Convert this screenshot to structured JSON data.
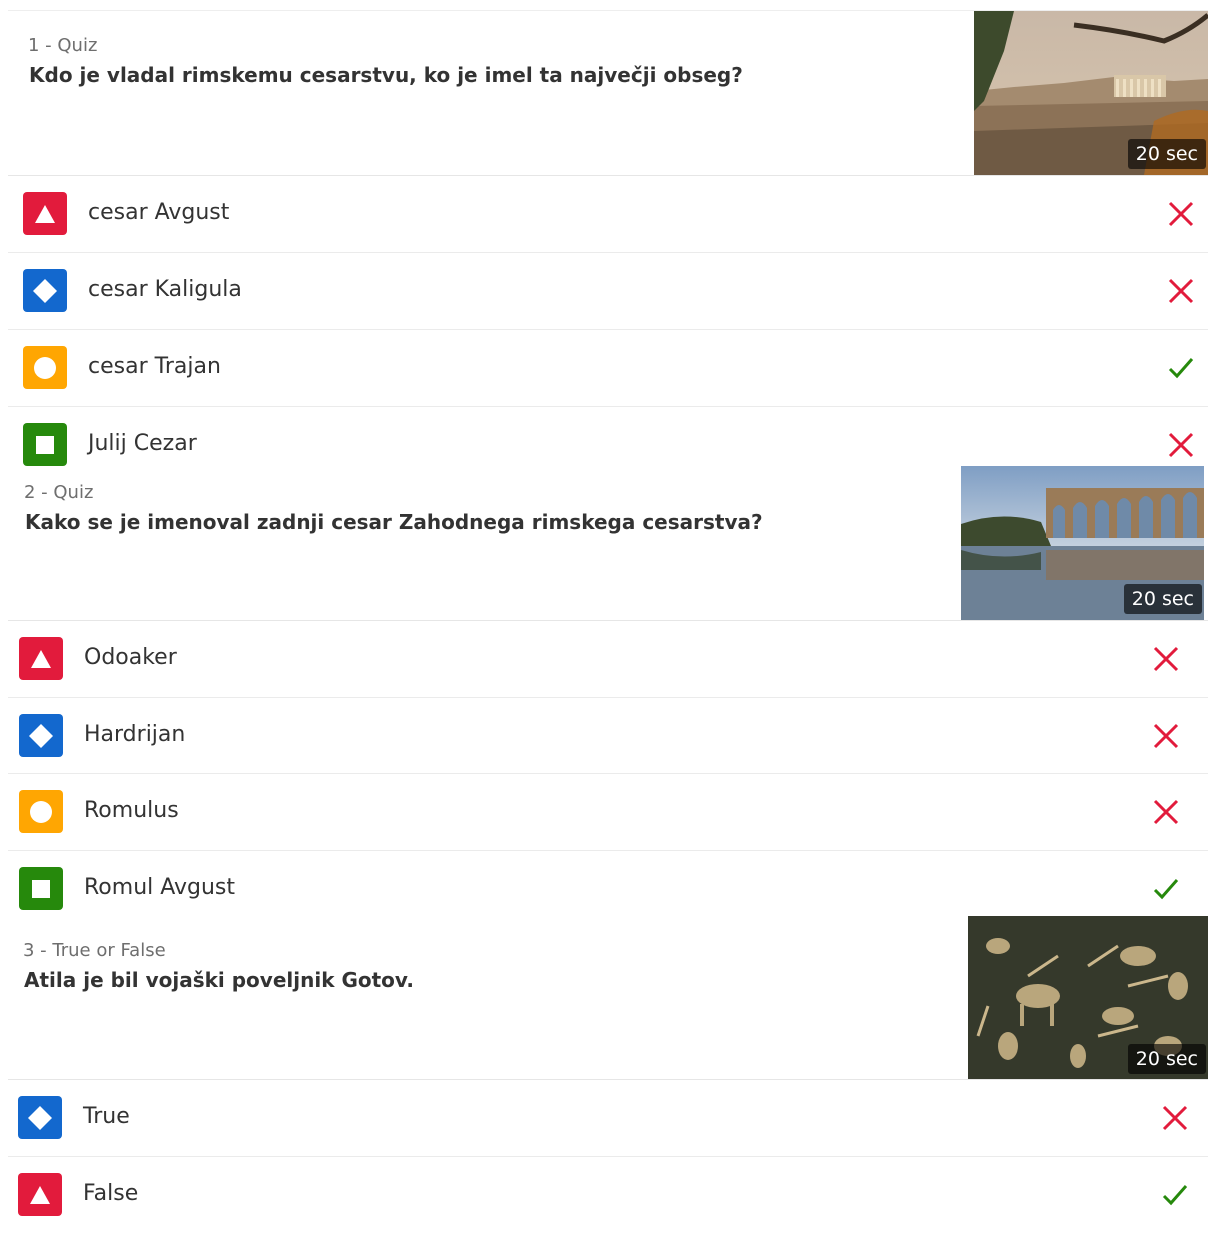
{
  "questions": [
    {
      "label": "1 - Quiz",
      "text": "Kdo je vladal rimskemu cesarstvu, ko je imel ta največji obseg?",
      "time": "20 sec",
      "image_icon": "acropolis-photo",
      "answers": [
        {
          "text": "cesar Avgust",
          "shape": "triangle",
          "color": "#e21b3c",
          "correct": false
        },
        {
          "text": "cesar Kaligula",
          "shape": "diamond",
          "color": "#1368ce",
          "correct": false
        },
        {
          "text": "cesar Trajan",
          "shape": "circle",
          "color": "#ffa602",
          "correct": true
        },
        {
          "text": "Julij Cezar",
          "shape": "square",
          "color": "#26890c",
          "correct": false
        }
      ]
    },
    {
      "label": "2 - Quiz",
      "text": "Kako se je imenoval zadnji cesar Zahodnega rimskega cesarstva?",
      "time": "20 sec",
      "image_icon": "aqueduct-photo",
      "answers": [
        {
          "text": "Odoaker",
          "shape": "triangle",
          "color": "#e21b3c",
          "correct": false
        },
        {
          "text": "Hardrijan",
          "shape": "diamond",
          "color": "#1368ce",
          "correct": false
        },
        {
          "text": "Romulus",
          "shape": "circle",
          "color": "#ffa602",
          "correct": false
        },
        {
          "text": "Romul Avgust",
          "shape": "square",
          "color": "#26890c",
          "correct": true
        }
      ]
    },
    {
      "label": "3 - True or False",
      "text": "Atila je bil vojaški poveljnik Gotov.",
      "time": "20 sec",
      "image_icon": "cave-painting-photo",
      "answers": [
        {
          "text": "True",
          "shape": "diamond",
          "color": "#1368ce",
          "correct": false
        },
        {
          "text": "False",
          "shape": "triangle",
          "color": "#e21b3c",
          "correct": true
        }
      ]
    }
  ],
  "status_colors": {
    "correct": "#26890c",
    "incorrect": "#e21b3c"
  }
}
